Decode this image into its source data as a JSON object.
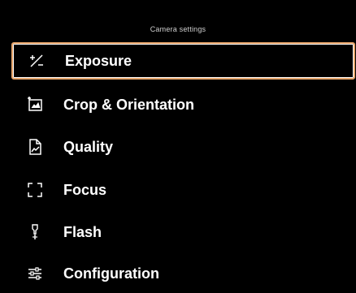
{
  "header": {
    "title": "Camera settings"
  },
  "menu": {
    "selected_index": 0,
    "accent_color": "#e7a56b",
    "items": [
      {
        "label": "Exposure",
        "icon": "exposure-icon"
      },
      {
        "label": "Crop & Orientation",
        "icon": "crop-orientation-icon"
      },
      {
        "label": "Quality",
        "icon": "quality-icon"
      },
      {
        "label": "Focus",
        "icon": "focus-icon"
      },
      {
        "label": "Flash",
        "icon": "flash-icon"
      },
      {
        "label": "Configuration",
        "icon": "configuration-icon"
      }
    ]
  }
}
